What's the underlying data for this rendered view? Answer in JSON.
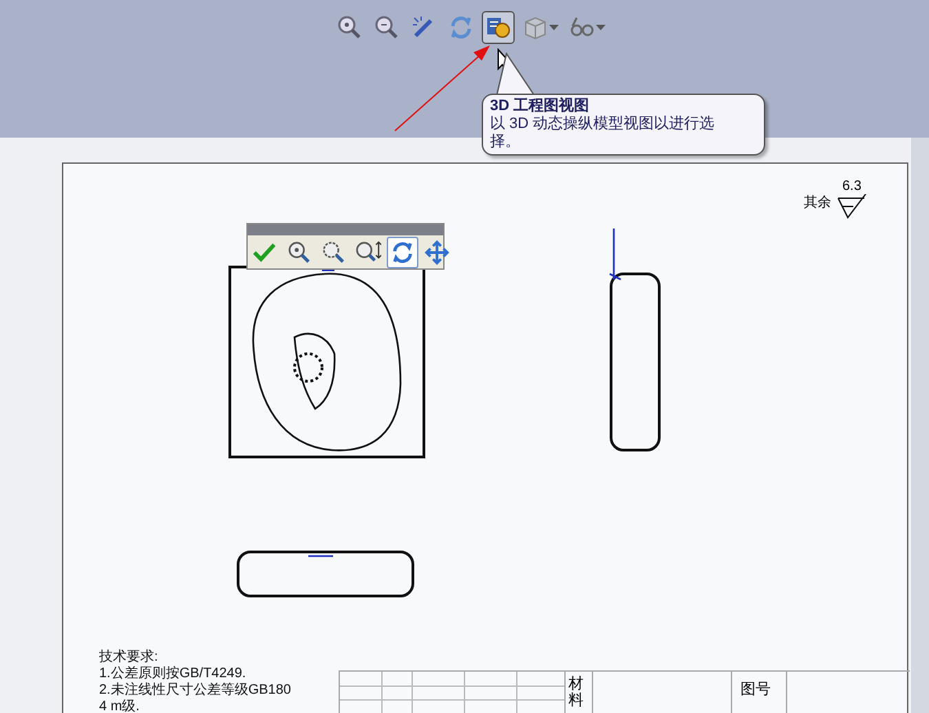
{
  "toolbar": {
    "buttons": [
      {
        "selected": false,
        "dropdown": false
      },
      {
        "selected": false,
        "dropdown": false
      },
      {
        "selected": false,
        "dropdown": false
      },
      {
        "selected": false,
        "dropdown": false
      },
      {
        "selected": true,
        "dropdown": false
      },
      {
        "selected": false,
        "dropdown": true
      },
      {
        "selected": false,
        "dropdown": true
      }
    ]
  },
  "tooltip": {
    "title": "3D 工程图视图",
    "body": "以 3D 动态操纵模型视图以进行选择。"
  },
  "mini_toolbar": {
    "buttons": [
      {
        "selected": false
      },
      {
        "selected": false
      },
      {
        "selected": false
      },
      {
        "selected": false
      },
      {
        "selected": true
      },
      {
        "selected": false
      }
    ]
  },
  "sheet": {
    "surface_finish": {
      "note": "其余",
      "value": "6.3"
    },
    "notes": [
      "技术要求:",
      "1.公差原则按GB/T4249.",
      "2.未注线性尺寸公差等级GB180",
      "4 m级."
    ],
    "title_block": {
      "material": "材料",
      "drawing_number": "图号"
    }
  }
}
